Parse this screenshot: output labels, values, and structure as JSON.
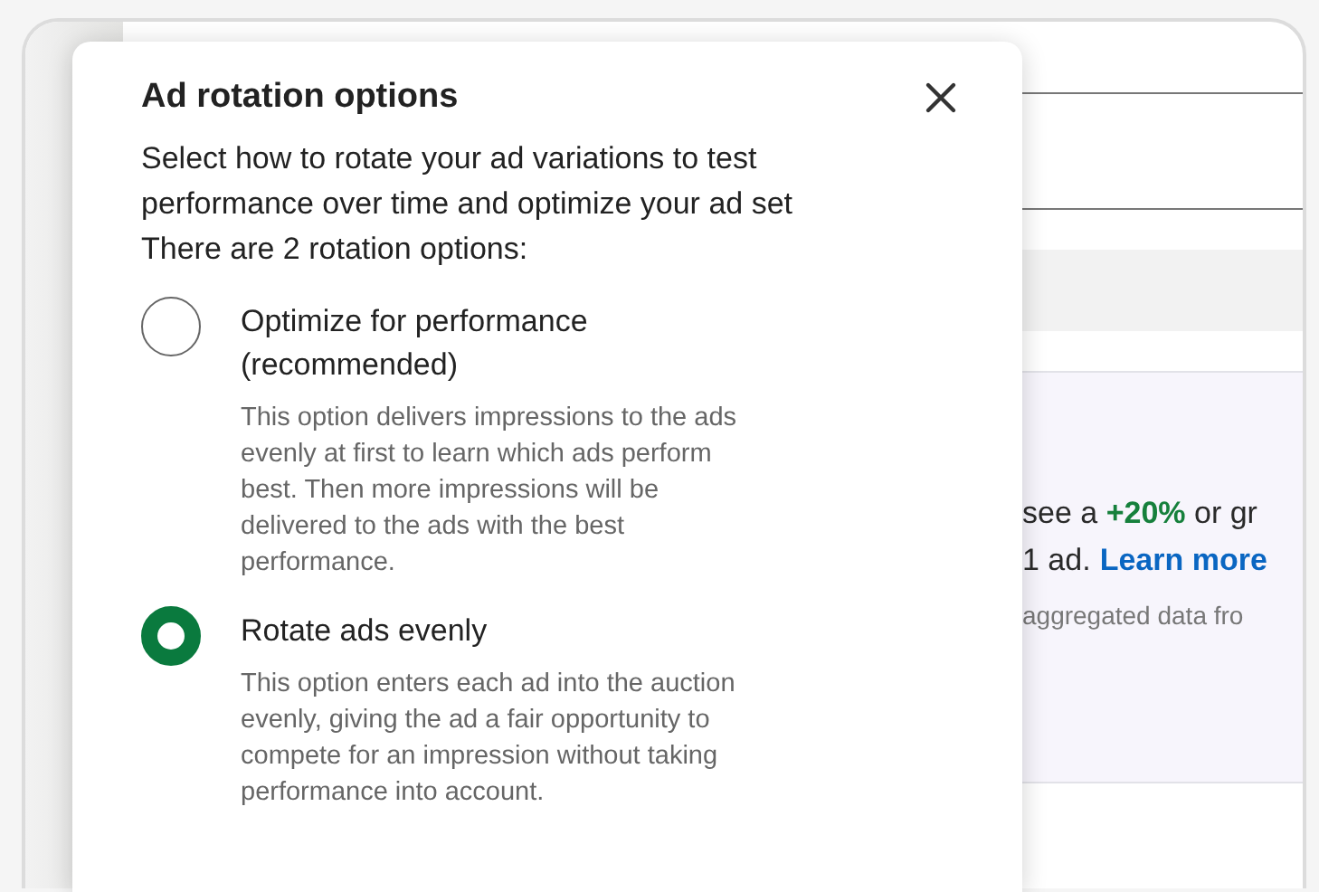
{
  "background": {
    "promo": {
      "line_1": "see a **+20%** or gr",
      "line_2": "1 ad.",
      "link": "Learn more",
      "note": "aggregated data fro"
    }
  },
  "dialog": {
    "title": "Ad rotation options",
    "description": "Select how to rotate your ad variations to test performance over time and optimize your ad set There are 2 rotation options:",
    "options": [
      {
        "label": "Optimize for performance (recommended)",
        "description": "This option delivers impressions to the ads evenly at first to learn which ads perform best. Then more impressions will be delivered to the ads with the best performance.",
        "selected": false
      },
      {
        "label": "Rotate ads evenly",
        "description": "This option enters each ad into the auction evenly, giving the ad a fair opportunity to compete for an impression without taking performance into account.",
        "selected": true
      }
    ]
  }
}
